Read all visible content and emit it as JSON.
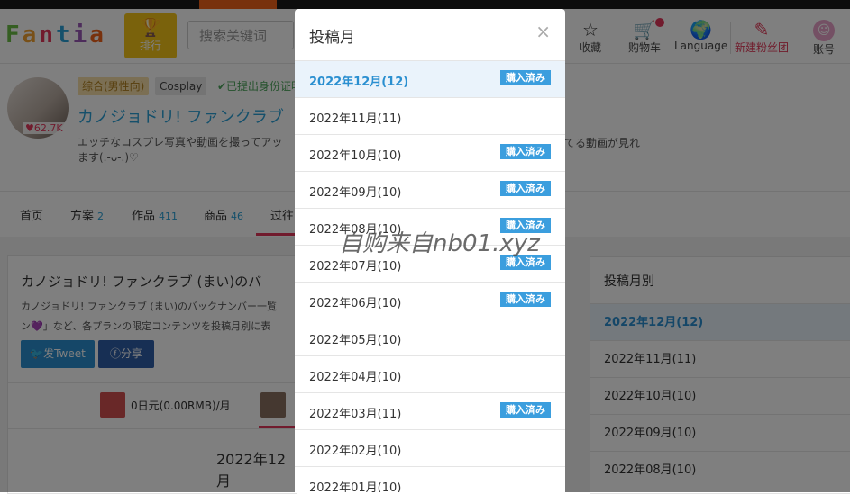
{
  "header": {
    "logo": "Fantia",
    "rank_label": "排行",
    "search_placeholder": "搜索关键词",
    "nav": {
      "favorites": "收藏",
      "cart": "购物车",
      "language": "Language",
      "new_fanclub": "新建粉丝团",
      "account": "账号"
    }
  },
  "profile": {
    "likes": "62.7K",
    "tags": [
      "综合(男性向)",
      "Cosplay",
      "✔已提出身份证明"
    ],
    "title": "カノジョドリ! ファンクラブ",
    "description": "エッチなコスプレ写真や動画を撮ってアッ",
    "description_cont": "ます(.-ᴗ-.)♡",
    "description_right": "てる動画が見れ"
  },
  "tabs": [
    {
      "label": "首页",
      "count": ""
    },
    {
      "label": "方案",
      "count": "2"
    },
    {
      "label": "作品",
      "count": "411"
    },
    {
      "label": "商品",
      "count": "46"
    },
    {
      "label": "过往",
      "count": ""
    }
  ],
  "card": {
    "title": "カノジョドリ! ファンクラブ (まい)のバ",
    "desc_line1": "カノジョドリ! ファンクラブ (まい)のバックナンバー一覧",
    "desc_line2": "ン💜」など、各プランの限定コンテンツを投稿月別に表",
    "tweet_label": "发Tweet",
    "share_label": "分享",
    "plan_text": "0日元(0.00RMB)/月",
    "month_heading": "2022年12月"
  },
  "sidebar": {
    "title": "投稿月別",
    "items": [
      "2022年12月(12)",
      "2022年11月(11)",
      "2022年10月(10)",
      "2022年09月(10)",
      "2022年08月(10)"
    ]
  },
  "modal": {
    "title": "投稿月",
    "close": "×",
    "badge_label": "購入済み",
    "items": [
      {
        "label": "2022年12月(12)",
        "purchased": true,
        "selected": true
      },
      {
        "label": "2022年11月(11)",
        "purchased": false,
        "selected": false
      },
      {
        "label": "2022年10月(10)",
        "purchased": true,
        "selected": false
      },
      {
        "label": "2022年09月(10)",
        "purchased": true,
        "selected": false
      },
      {
        "label": "2022年08月(10)",
        "purchased": true,
        "selected": false
      },
      {
        "label": "2022年07月(10)",
        "purchased": true,
        "selected": false
      },
      {
        "label": "2022年06月(10)",
        "purchased": true,
        "selected": false
      },
      {
        "label": "2022年05月(10)",
        "purchased": false,
        "selected": false
      },
      {
        "label": "2022年04月(10)",
        "purchased": false,
        "selected": false
      },
      {
        "label": "2022年03月(11)",
        "purchased": true,
        "selected": false
      },
      {
        "label": "2022年02月(10)",
        "purchased": false,
        "selected": false
      },
      {
        "label": "2022年01月(10)",
        "purchased": false,
        "selected": false
      }
    ]
  },
  "watermark": "自购来自nb01.xyz",
  "colors": {
    "accent": "#2a8fd0",
    "pink": "#e2365a",
    "rank": "#f5c518",
    "badge": "#3b9ede"
  }
}
